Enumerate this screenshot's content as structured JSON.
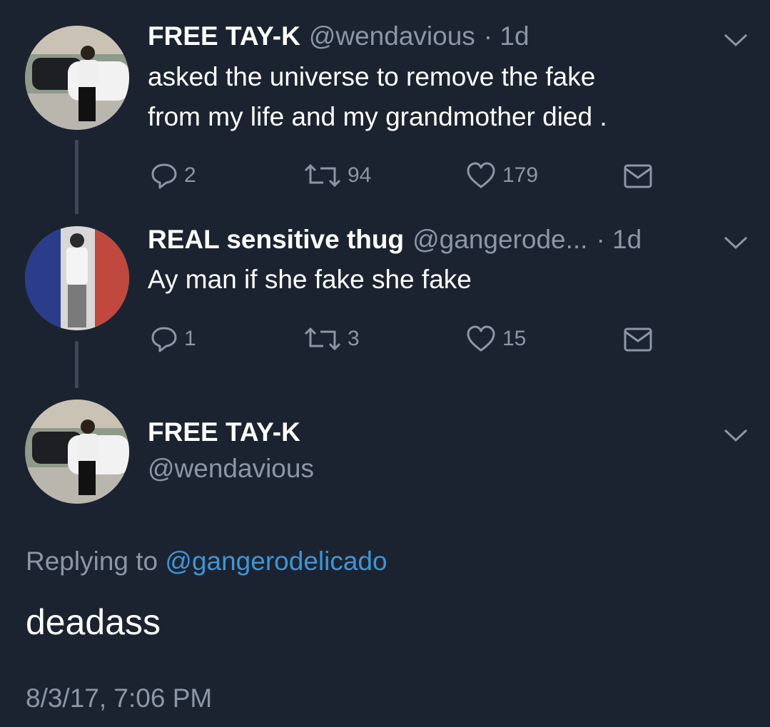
{
  "tweets": [
    {
      "name": "FREE TAY-K",
      "handle": "@wendavious",
      "time": "· 1d",
      "text_lines": [
        "asked the universe to remove the fake",
        "from my life and my grandmother died ."
      ],
      "replies": "2",
      "retweets": "94",
      "likes": "179"
    },
    {
      "name": "REAL sensitive thug",
      "handle": "@gangerode...",
      "time": "· 1d",
      "text_lines": [
        "Ay man if she fake she fake"
      ],
      "replies": "1",
      "retweets": "3",
      "likes": "15"
    }
  ],
  "main_tweet": {
    "name": "FREE TAY-K",
    "handle": "@wendavious",
    "replying_prefix": "Replying to",
    "replying_handle": "@gangerodelicado",
    "text": "deadass",
    "timestamp": "8/3/17, 7:06 PM"
  },
  "icons": {
    "reply": "reply-bubble-icon",
    "retweet": "retweet-icon",
    "like": "heart-icon",
    "dm": "envelope-icon",
    "more": "chevron-down-icon"
  },
  "colors": {
    "background": "#1c2330",
    "secondary_text": "#8a97a6",
    "link": "#3e95d6"
  }
}
